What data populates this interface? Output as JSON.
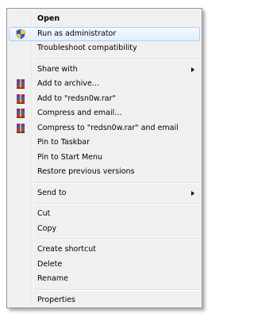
{
  "context_menu": {
    "open": "Open",
    "run_as_admin": "Run as administrator",
    "troubleshoot": "Troubleshoot compatibility",
    "share_with": "Share with",
    "add_to_archive": "Add to archive...",
    "add_to_rar": "Add to \"redsn0w.rar\"",
    "compress_email": "Compress and email...",
    "compress_rar_email": "Compress to \"redsn0w.rar\" and email",
    "pin_taskbar": "Pin to Taskbar",
    "pin_start": "Pin to Start Menu",
    "restore_versions": "Restore previous versions",
    "send_to": "Send to",
    "cut": "Cut",
    "copy": "Copy",
    "create_shortcut": "Create shortcut",
    "delete": "Delete",
    "rename": "Rename",
    "properties": "Properties"
  },
  "icons": {
    "shield": "uac-shield-icon",
    "winrar": "winrar-icon"
  }
}
